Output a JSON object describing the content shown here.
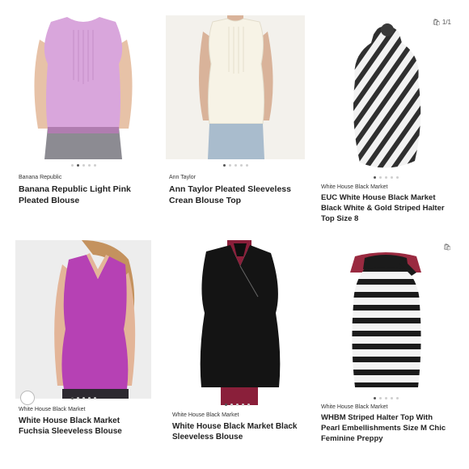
{
  "listings": [
    {
      "brand": "Banana Republic",
      "title": "Banana Republic Light Pink Pleated Blouse",
      "dots": 5,
      "active_dot": 1,
      "colors": {
        "garment": "#d9a6dc",
        "bg": "#ffffff",
        "skin": "#e7c2a7",
        "bottom": "#8c8b92"
      }
    },
    {
      "brand": "Ann Taylor",
      "title": "Ann Taylor Pleated Sleeveless Crean Blouse Top",
      "dots": 5,
      "active_dot": 0,
      "colors": {
        "garment": "#f3efe2",
        "bg": "#f2f0ed",
        "skin": "#d9b39a",
        "bottom": "#a9bccd"
      }
    },
    {
      "brand": "White House Black Market",
      "title": "EUC White House Black Market Black White & Gold Striped Halter Top Size 8",
      "dots": 5,
      "active_dot": 0,
      "corner_icon": "🛍 1/1",
      "colors": {
        "garment": "#3a3a3a",
        "bg": "#ffffff",
        "accent": "#cfc8bf"
      }
    },
    {
      "brand": "White House Black Market",
      "title": "White House Black Market Fuchsia Sleeveless Blouse",
      "dots": 5,
      "active_dot": 0,
      "colors": {
        "garment": "#b641b4",
        "bg": "#ededed",
        "skin": "#e3b598",
        "bottom": "#2c2930"
      }
    },
    {
      "brand": "White House Black Market",
      "title": "White House Black Market Black Sleeveless Blouse",
      "dots": 5,
      "active_dot": 0,
      "colors": {
        "garment": "#141414",
        "bg": "#ffffff",
        "form": "#8a1f3a"
      }
    },
    {
      "brand": "White House Black Market",
      "title": "WHBM  Striped Halter Top With Pearl Embellishments Size M Chic Feminine Preppy",
      "dots": 5,
      "active_dot": 0,
      "corner_icon": "🛍",
      "colors": {
        "garment": "#1b1b1b",
        "stripe": "#f3f3f3",
        "bg": "#ffffff",
        "form": "#9a2a40"
      }
    }
  ]
}
